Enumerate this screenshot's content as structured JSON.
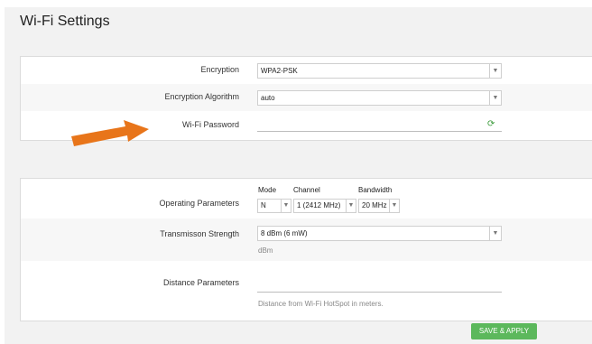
{
  "page": {
    "title": "Wi-Fi Settings"
  },
  "security": {
    "encryption": {
      "label": "Encryption",
      "value": "WPA2-PSK"
    },
    "algorithm": {
      "label": "Encryption Algorithm",
      "value": "auto"
    },
    "password": {
      "label": "Wi-Fi Password",
      "value": ""
    }
  },
  "radio": {
    "operating": {
      "label": "Operating Parameters",
      "mode_label": "Mode",
      "mode_value": "N",
      "channel_label": "Channel",
      "channel_value": "1 (2412 MHz)",
      "bandwidth_label": "Bandwidth",
      "bandwidth_value": "20 MHz"
    },
    "tx_strength": {
      "label": "Transmisson Strength",
      "value": "8 dBm (6 mW)",
      "unit_hint": "dBm"
    },
    "distance": {
      "label": "Distance Parameters",
      "value": "",
      "hint": "Distance from Wi-Fi HotSpot in meters."
    }
  },
  "actions": {
    "save_apply": "SAVE & APPLY"
  },
  "icons": {
    "dropdown": "chevron-down-icon",
    "refresh": "refresh-icon",
    "arrow": "orange-arrow-annotation"
  },
  "colors": {
    "accent": "#5cb85c",
    "annotation": "#e8751a"
  }
}
